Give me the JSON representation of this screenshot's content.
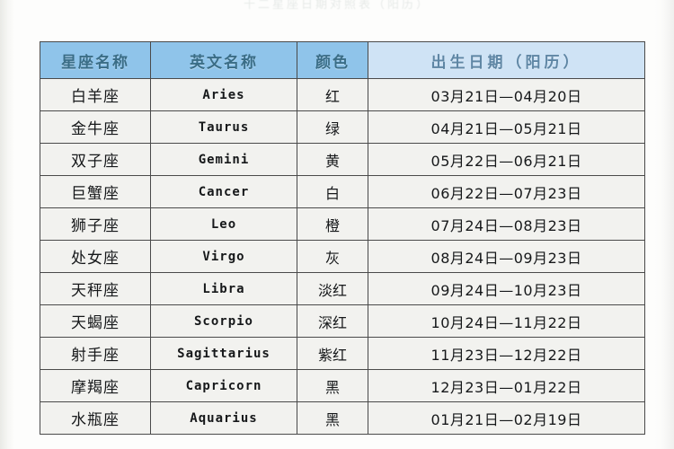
{
  "page": {
    "clipped_title": "十二星座日期对照表（阳历）",
    "background_color": "#fdfdfc"
  },
  "table": {
    "header_color": "#8fc4ea",
    "header_date_color": "#cfe3f5",
    "cell_color": "#f2f2ef",
    "border_color": "#4a4a4a",
    "columns": [
      {
        "key": "name",
        "label": "星座名称"
      },
      {
        "key": "english",
        "label": "英文名称"
      },
      {
        "key": "color",
        "label": "颜色"
      },
      {
        "key": "date",
        "label": "出生日期（阳历）"
      }
    ],
    "rows": [
      {
        "name": "白羊座",
        "english": "Aries",
        "color": "红",
        "date": "03月21日—04月20日"
      },
      {
        "name": "金牛座",
        "english": "Taurus",
        "color": "绿",
        "date": "04月21日—05月21日"
      },
      {
        "name": "双子座",
        "english": "Gemini",
        "color": "黄",
        "date": "05月22日—06月21日"
      },
      {
        "name": "巨蟹座",
        "english": "Cancer",
        "color": "白",
        "date": "06月22日—07月23日"
      },
      {
        "name": "狮子座",
        "english": "Leo",
        "color": "橙",
        "date": "07月24日—08月23日"
      },
      {
        "name": "处女座",
        "english": "Virgo",
        "color": "灰",
        "date": "08月24日—09月23日"
      },
      {
        "name": "天秤座",
        "english": "Libra",
        "color": "淡红",
        "date": "09月24日—10月23日"
      },
      {
        "name": "天蝎座",
        "english": "Scorpio",
        "color": "深红",
        "date": "10月24日—11月22日"
      },
      {
        "name": "射手座",
        "english": "Sagittarius",
        "color": "紫红",
        "date": "11月23日—12月22日"
      },
      {
        "name": "摩羯座",
        "english": "Capricorn",
        "color": "黑",
        "date": "12月23日—01月22日"
      },
      {
        "name": "水瓶座",
        "english": "Aquarius",
        "color": "黑",
        "date": "01月21日—02月19日"
      }
    ]
  }
}
